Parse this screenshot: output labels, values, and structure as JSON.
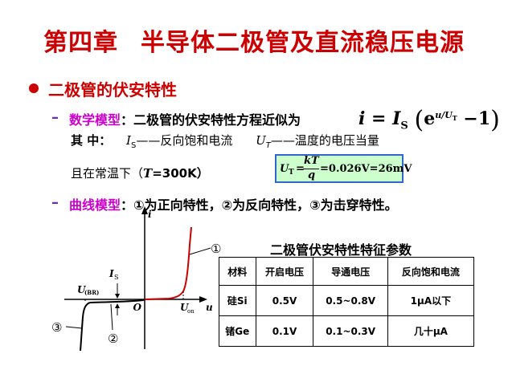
{
  "title": {
    "chapter": "第四章",
    "text": "半导体二极管及直流稳压电源"
  },
  "section": {
    "heading": "二极管的伏安特性"
  },
  "math_model": {
    "label": "数学模型",
    "text": "：二极管的伏安特性方程近似为",
    "formula_lhs": "i = I",
    "formula_sub": "S",
    "formula_exp": "u/U",
    "formula_exp_sub": "T",
    "formula_base": "e",
    "formula_tail": "−1",
    "where_label": "其 中：",
    "is_symbol": "I",
    "is_sub": "S",
    "is_desc": "——反向饱和电流",
    "ut_symbol": "U",
    "ut_sub": "T",
    "ut_desc": "——温度的电压当量",
    "room_temp_prefix": "且在常温下（",
    "room_temp_T": "T",
    "room_temp_suffix": "=300K）",
    "box_lhs": "U",
    "box_lhs_sub": "T",
    "box_num": "kT",
    "box_den": "q",
    "box_value": "=0.026V=26mV"
  },
  "curve_model": {
    "label": "曲线模型",
    "text": "：①为正向特性，②为反向特性，③为击穿特性。"
  },
  "graph": {
    "axis_i": "i",
    "axis_u": "u",
    "origin": "O",
    "is_label": "I",
    "is_sub": "S",
    "ubr_label": "U",
    "ubr_sub": "(BR)",
    "uon_label": "U",
    "uon_sub": "on",
    "marker1": "①",
    "marker2": "②",
    "marker3": "③",
    "curve_color": "#cc0000"
  },
  "table": {
    "title": "二极管伏安特性特征参数",
    "headers": [
      "材料",
      "开启电压",
      "导通电压",
      "反向饱和电流"
    ],
    "rows": [
      [
        "硅Si",
        "0.5V",
        "0.5~0.8V",
        "1μA以下"
      ],
      [
        "锗Ge",
        "0.1V",
        "0.1~0.3V",
        "几十μA"
      ]
    ]
  }
}
